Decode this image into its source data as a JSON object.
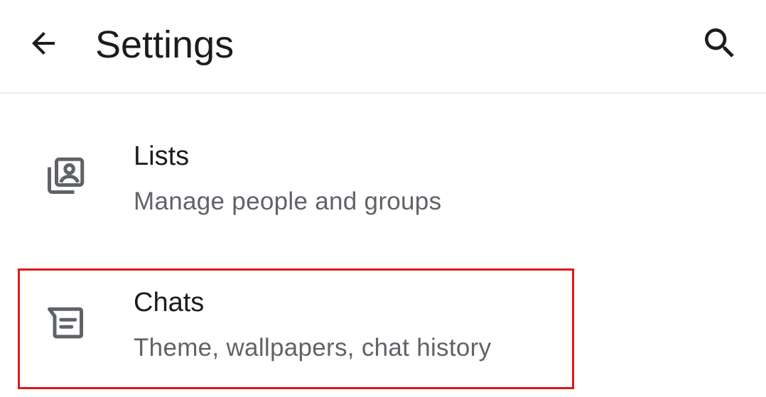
{
  "header": {
    "title": "Settings",
    "back_icon": "arrow-back-icon",
    "search_icon": "search-icon"
  },
  "items": [
    {
      "title": "Lists",
      "subtitle": "Manage people and groups",
      "icon": "contact-list-icon"
    },
    {
      "title": "Chats",
      "subtitle": "Theme, wallpapers, chat history",
      "icon": "chat-icon"
    }
  ],
  "colors": {
    "text_primary": "#1c1c1c",
    "text_secondary": "#5f6368",
    "icon": "#5f6368",
    "highlight": "#e01818",
    "divider": "#ececec"
  }
}
